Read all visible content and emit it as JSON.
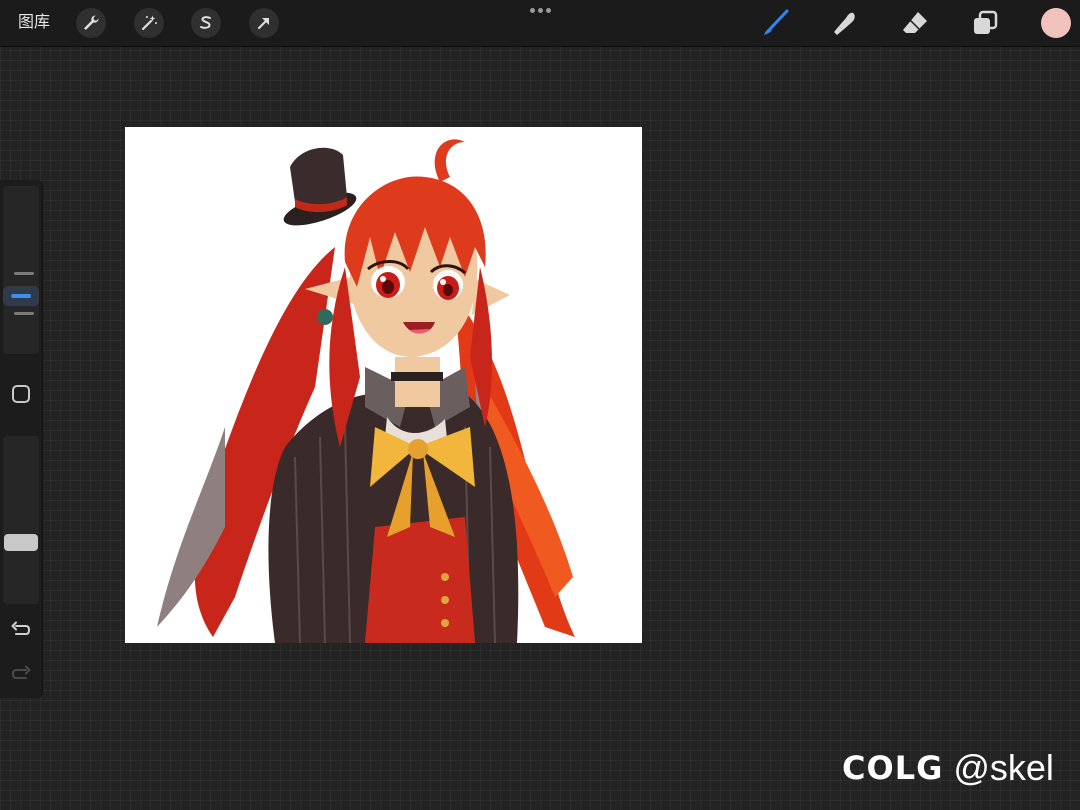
{
  "topbar": {
    "gallery_label": "图库",
    "left_tools": [
      {
        "name": "actions",
        "icon": "wrench-icon"
      },
      {
        "name": "adjustments",
        "icon": "magic-wand-icon"
      },
      {
        "name": "selection",
        "icon": "selection-s-icon"
      },
      {
        "name": "transform",
        "icon": "arrow-cursor-icon"
      }
    ],
    "right_tools": [
      {
        "name": "brush",
        "icon": "brush-icon",
        "active": true
      },
      {
        "name": "smudge",
        "icon": "smudge-finger-icon",
        "active": false
      },
      {
        "name": "eraser",
        "icon": "eraser-icon",
        "active": false
      },
      {
        "name": "layers",
        "icon": "layers-icon",
        "active": false
      }
    ],
    "current_color": "#f2c2bc",
    "accent_color": "#2f86f6"
  },
  "sidebar": {
    "brush_size_level": 0.7,
    "brush_opacity_level": 0.35,
    "modify_icon": "square-outline-icon",
    "undo_icon": "undo-arrow-icon",
    "redo_icon": "redo-arrow-icon",
    "redo_enabled": false
  },
  "canvas": {
    "background": "#ffffff",
    "artwork": "anime-girl-illustration"
  },
  "watermark": {
    "logo": "COLG",
    "handle": "@skel"
  }
}
